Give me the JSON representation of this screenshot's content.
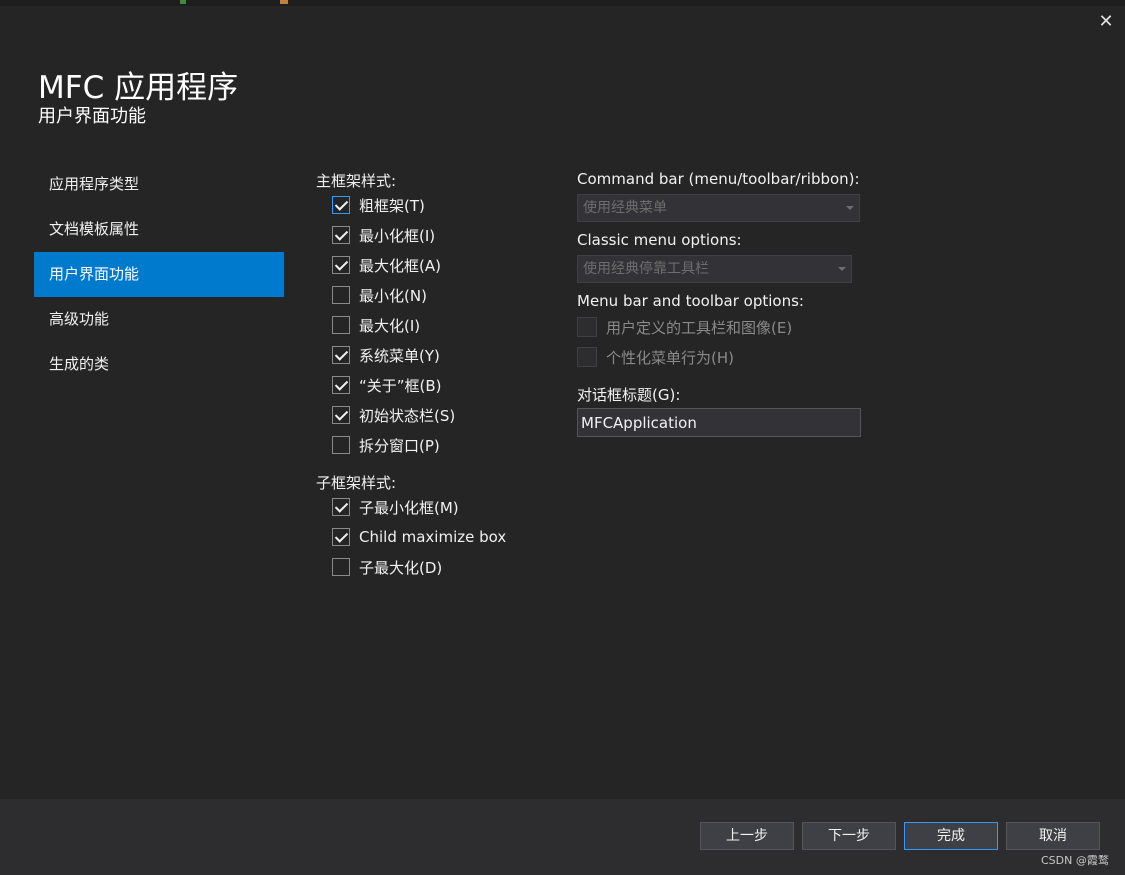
{
  "window": {
    "close_icon": "close-icon"
  },
  "header": {
    "title": "MFC 应用程序",
    "subtitle": "用户界面功能"
  },
  "nav": {
    "items": [
      {
        "label": "应用程序类型",
        "active": false
      },
      {
        "label": "文档模板属性",
        "active": false
      },
      {
        "label": "用户界面功能",
        "active": true
      },
      {
        "label": "高级功能",
        "active": false
      },
      {
        "label": "生成的类",
        "active": false
      }
    ]
  },
  "main_frame": {
    "label": "主框架样式:",
    "options": [
      {
        "label": "粗框架(T)",
        "checked": true
      },
      {
        "label": "最小化框(I)",
        "checked": true
      },
      {
        "label": "最大化框(A)",
        "checked": true
      },
      {
        "label": "最小化(N)",
        "checked": false
      },
      {
        "label": "最大化(I)",
        "checked": false
      },
      {
        "label": "系统菜单(Y)",
        "checked": true
      },
      {
        "label": "“关于”框(B)",
        "checked": true
      },
      {
        "label": "初始状态栏(S)",
        "checked": true
      },
      {
        "label": "拆分窗口(P)",
        "checked": false
      }
    ]
  },
  "child_frame": {
    "label": "子框架样式:",
    "options": [
      {
        "label": "子最小化框(M)",
        "checked": true
      },
      {
        "label": "Child maximize box",
        "checked": true
      },
      {
        "label": "子最大化(D)",
        "checked": false
      }
    ]
  },
  "command_bar": {
    "label": "Command bar (menu/toolbar/ribbon):",
    "value": "使用经典菜单"
  },
  "classic_menu": {
    "label": "Classic menu options:",
    "value": "使用经典停靠工具栏"
  },
  "menu_toolbar": {
    "label": "Menu bar and toolbar options:",
    "options": [
      {
        "label": "用户定义的工具栏和图像(E)",
        "checked": false,
        "disabled": true
      },
      {
        "label": "个性化菜单行为(H)",
        "checked": false,
        "disabled": true
      }
    ]
  },
  "dialog_title": {
    "label": "对话框标题(G):",
    "value": "MFCApplication"
  },
  "buttons": {
    "prev": "上一步",
    "next": "下一步",
    "finish": "完成",
    "cancel": "取消"
  },
  "watermark": "CSDN @霞鹜",
  "colors": {
    "accent": "#007acc",
    "background": "#252526",
    "footer": "#2d2d30"
  }
}
